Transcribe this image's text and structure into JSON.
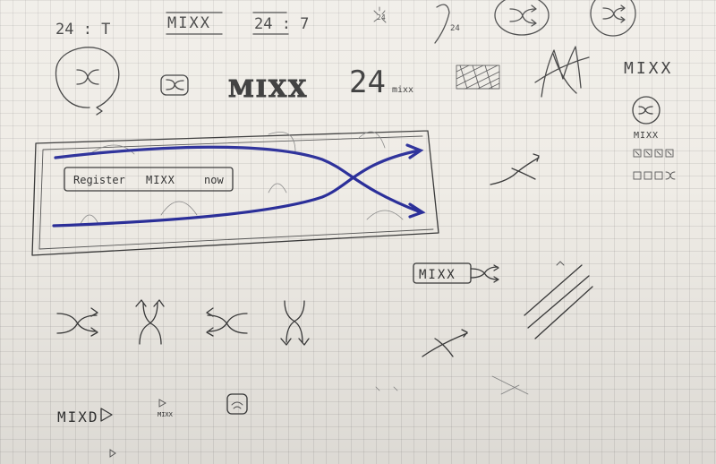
{
  "sketch": {
    "top_row": {
      "label_24t": "24 : T",
      "mixx": "MIXX",
      "label_24_7": "24 : 7",
      "star_24": "24",
      "slash_24": "24"
    },
    "second_row": {
      "mixx_outline": "MIXX",
      "label_24": "24",
      "label_mixx_small": "mixx"
    },
    "right_column": {
      "mixx_script": "MIXX",
      "mixx_under_icon": "MIXX"
    },
    "banner": {
      "register": "Register",
      "mixx": "MIXX",
      "now": "now"
    },
    "mid_right": {
      "mixx_boxed": "MIXX"
    },
    "bottom": {
      "mixd": "MIXD",
      "mixx_tiny": "MIXX"
    }
  },
  "colors": {
    "paper": "#efece6",
    "ink": "#3a3a3a",
    "blue_ink": "#2b2f9a",
    "grid": "#9a9a9a"
  }
}
